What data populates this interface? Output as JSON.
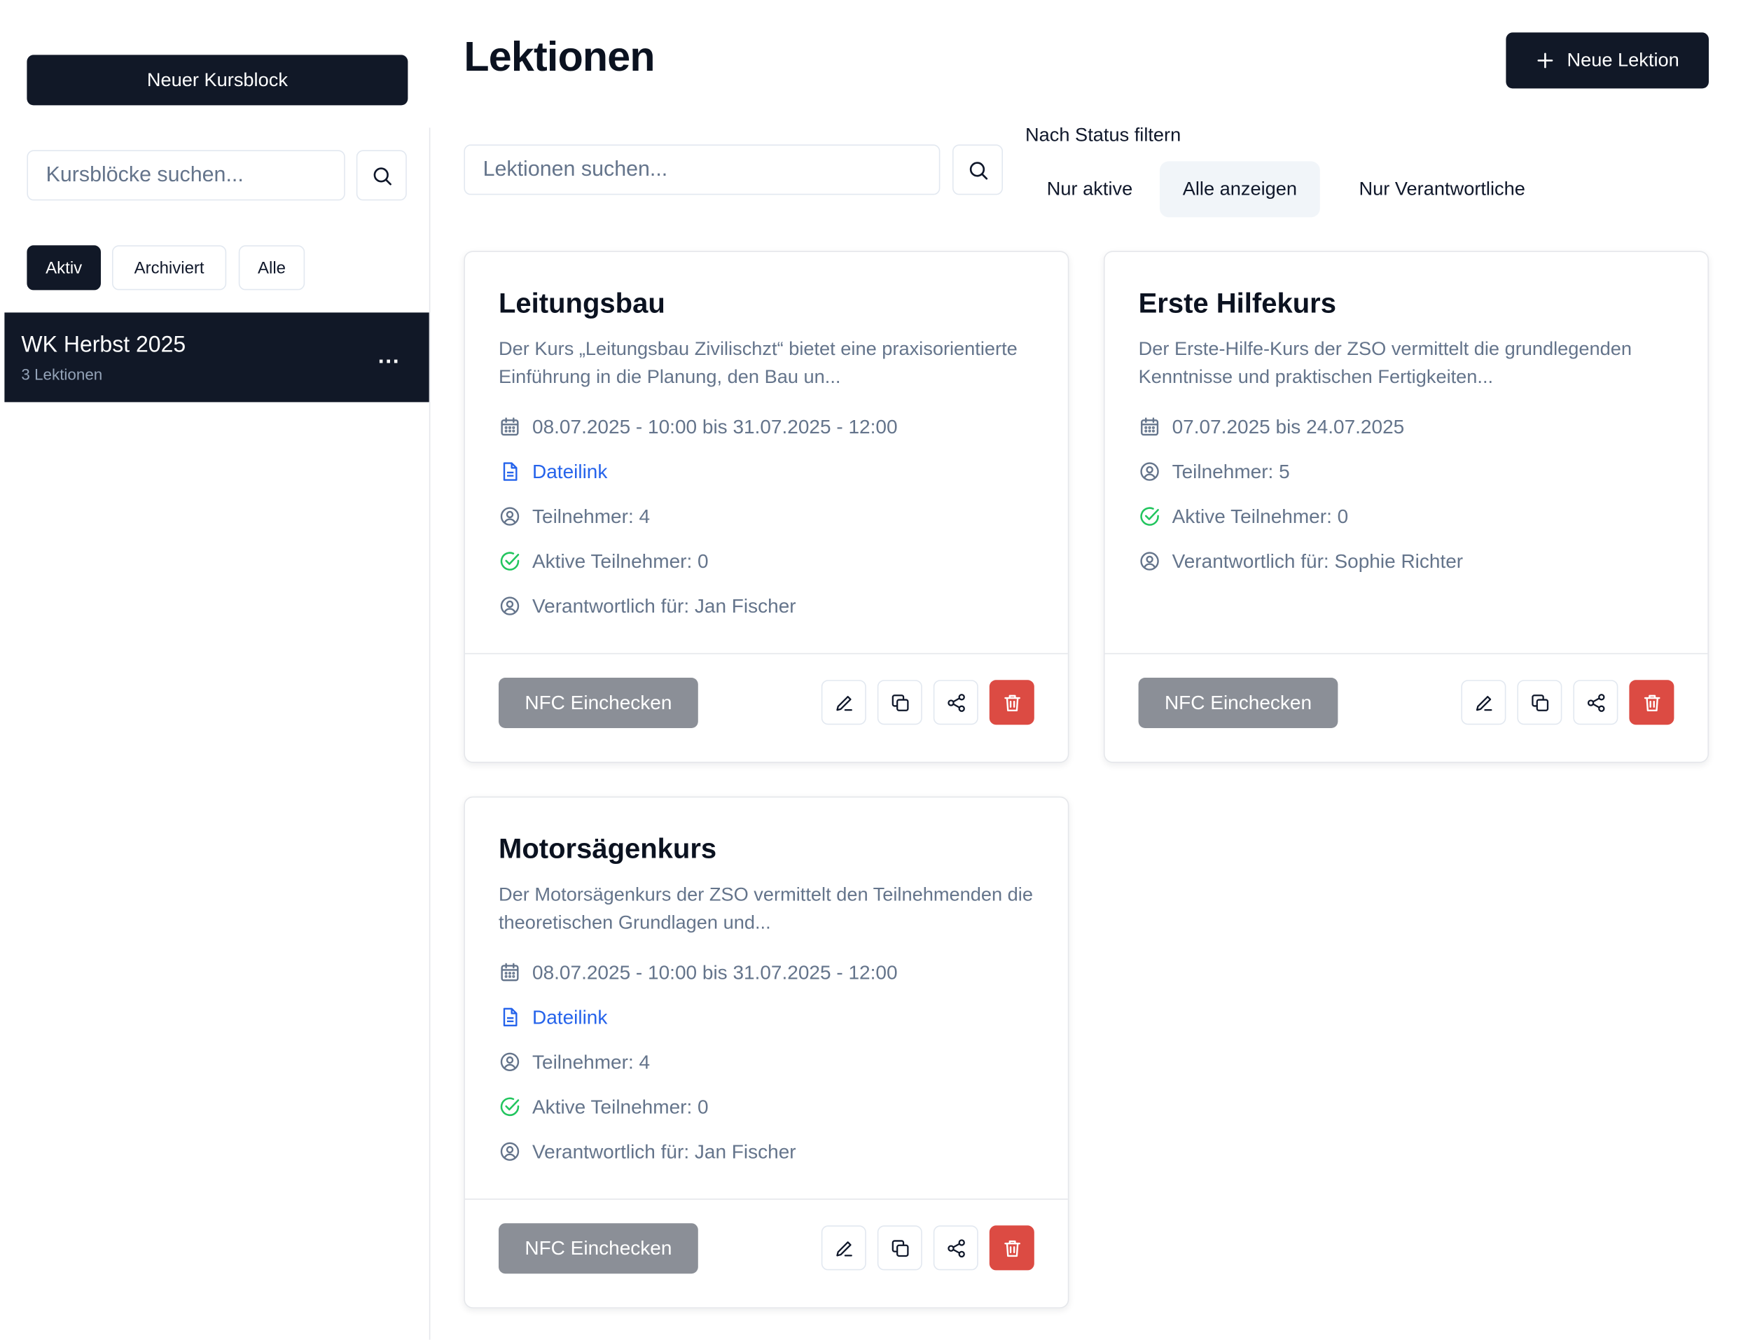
{
  "sidebar": {
    "new_block_label": "Neuer Kursblock",
    "search_placeholder": "Kursblöcke suchen...",
    "filters": [
      "Aktiv",
      "Archiviert",
      "Alle"
    ],
    "active_filter": "Aktiv",
    "blocks": [
      {
        "title": "WK Herbst 2025",
        "subtitle": "3 Lektionen",
        "menu": "..."
      }
    ]
  },
  "header": {
    "title": "Lektionen",
    "new_lesson_label": "Neue Lektion"
  },
  "toolbar": {
    "search_placeholder": "Lektionen suchen...",
    "status_filter_label": "Nach Status filtern",
    "status_tabs": [
      "Nur aktive",
      "Alle anzeigen",
      "Nur Verantwortliche"
    ],
    "active_status_tab": "Alle anzeigen"
  },
  "cards": [
    {
      "title": "Leitungsbau",
      "description": "Der Kurs „Leitungsbau Zivilischzt“ bietet eine praxisorientierte Einführung in die Planung, den Bau un...",
      "date": "08.07.2025 - 10:00 bis 31.07.2025 - 12:00",
      "file_link": "Dateilink",
      "participants": "Teilnehmer: 4",
      "active_participants": "Aktive Teilnehmer: 0",
      "responsible": "Verantwortlich für: Jan Fischer",
      "nfc_label": "NFC Einchecken"
    },
    {
      "title": "Erste Hilfekurs",
      "description": "Der Erste-Hilfe-Kurs der ZSO vermittelt die grundlegenden Kenntnisse und praktischen Fertigkeiten...",
      "date": "07.07.2025 bis 24.07.2025",
      "participants": "Teilnehmer: 5",
      "active_participants": "Aktive Teilnehmer: 0",
      "responsible": "Verantwortlich für: Sophie Richter",
      "nfc_label": "NFC Einchecken"
    },
    {
      "title": "Motorsägenkurs",
      "description": "Der Motorsägenkurs der ZSO vermittelt den Teilnehmenden die theoretischen Grundlagen und...",
      "date": "08.07.2025 - 10:00 bis 31.07.2025 - 12:00",
      "file_link": "Dateilink",
      "participants": "Teilnehmer: 4",
      "active_participants": "Aktive Teilnehmer: 0",
      "responsible": "Verantwortlich für: Jan Fischer",
      "nfc_label": "NFC Einchecken"
    }
  ],
  "colors": {
    "primary": "#111827",
    "link": "#2563eb",
    "success": "#22c55e",
    "danger": "#dc4b43",
    "muted_button": "#8b8f97"
  }
}
